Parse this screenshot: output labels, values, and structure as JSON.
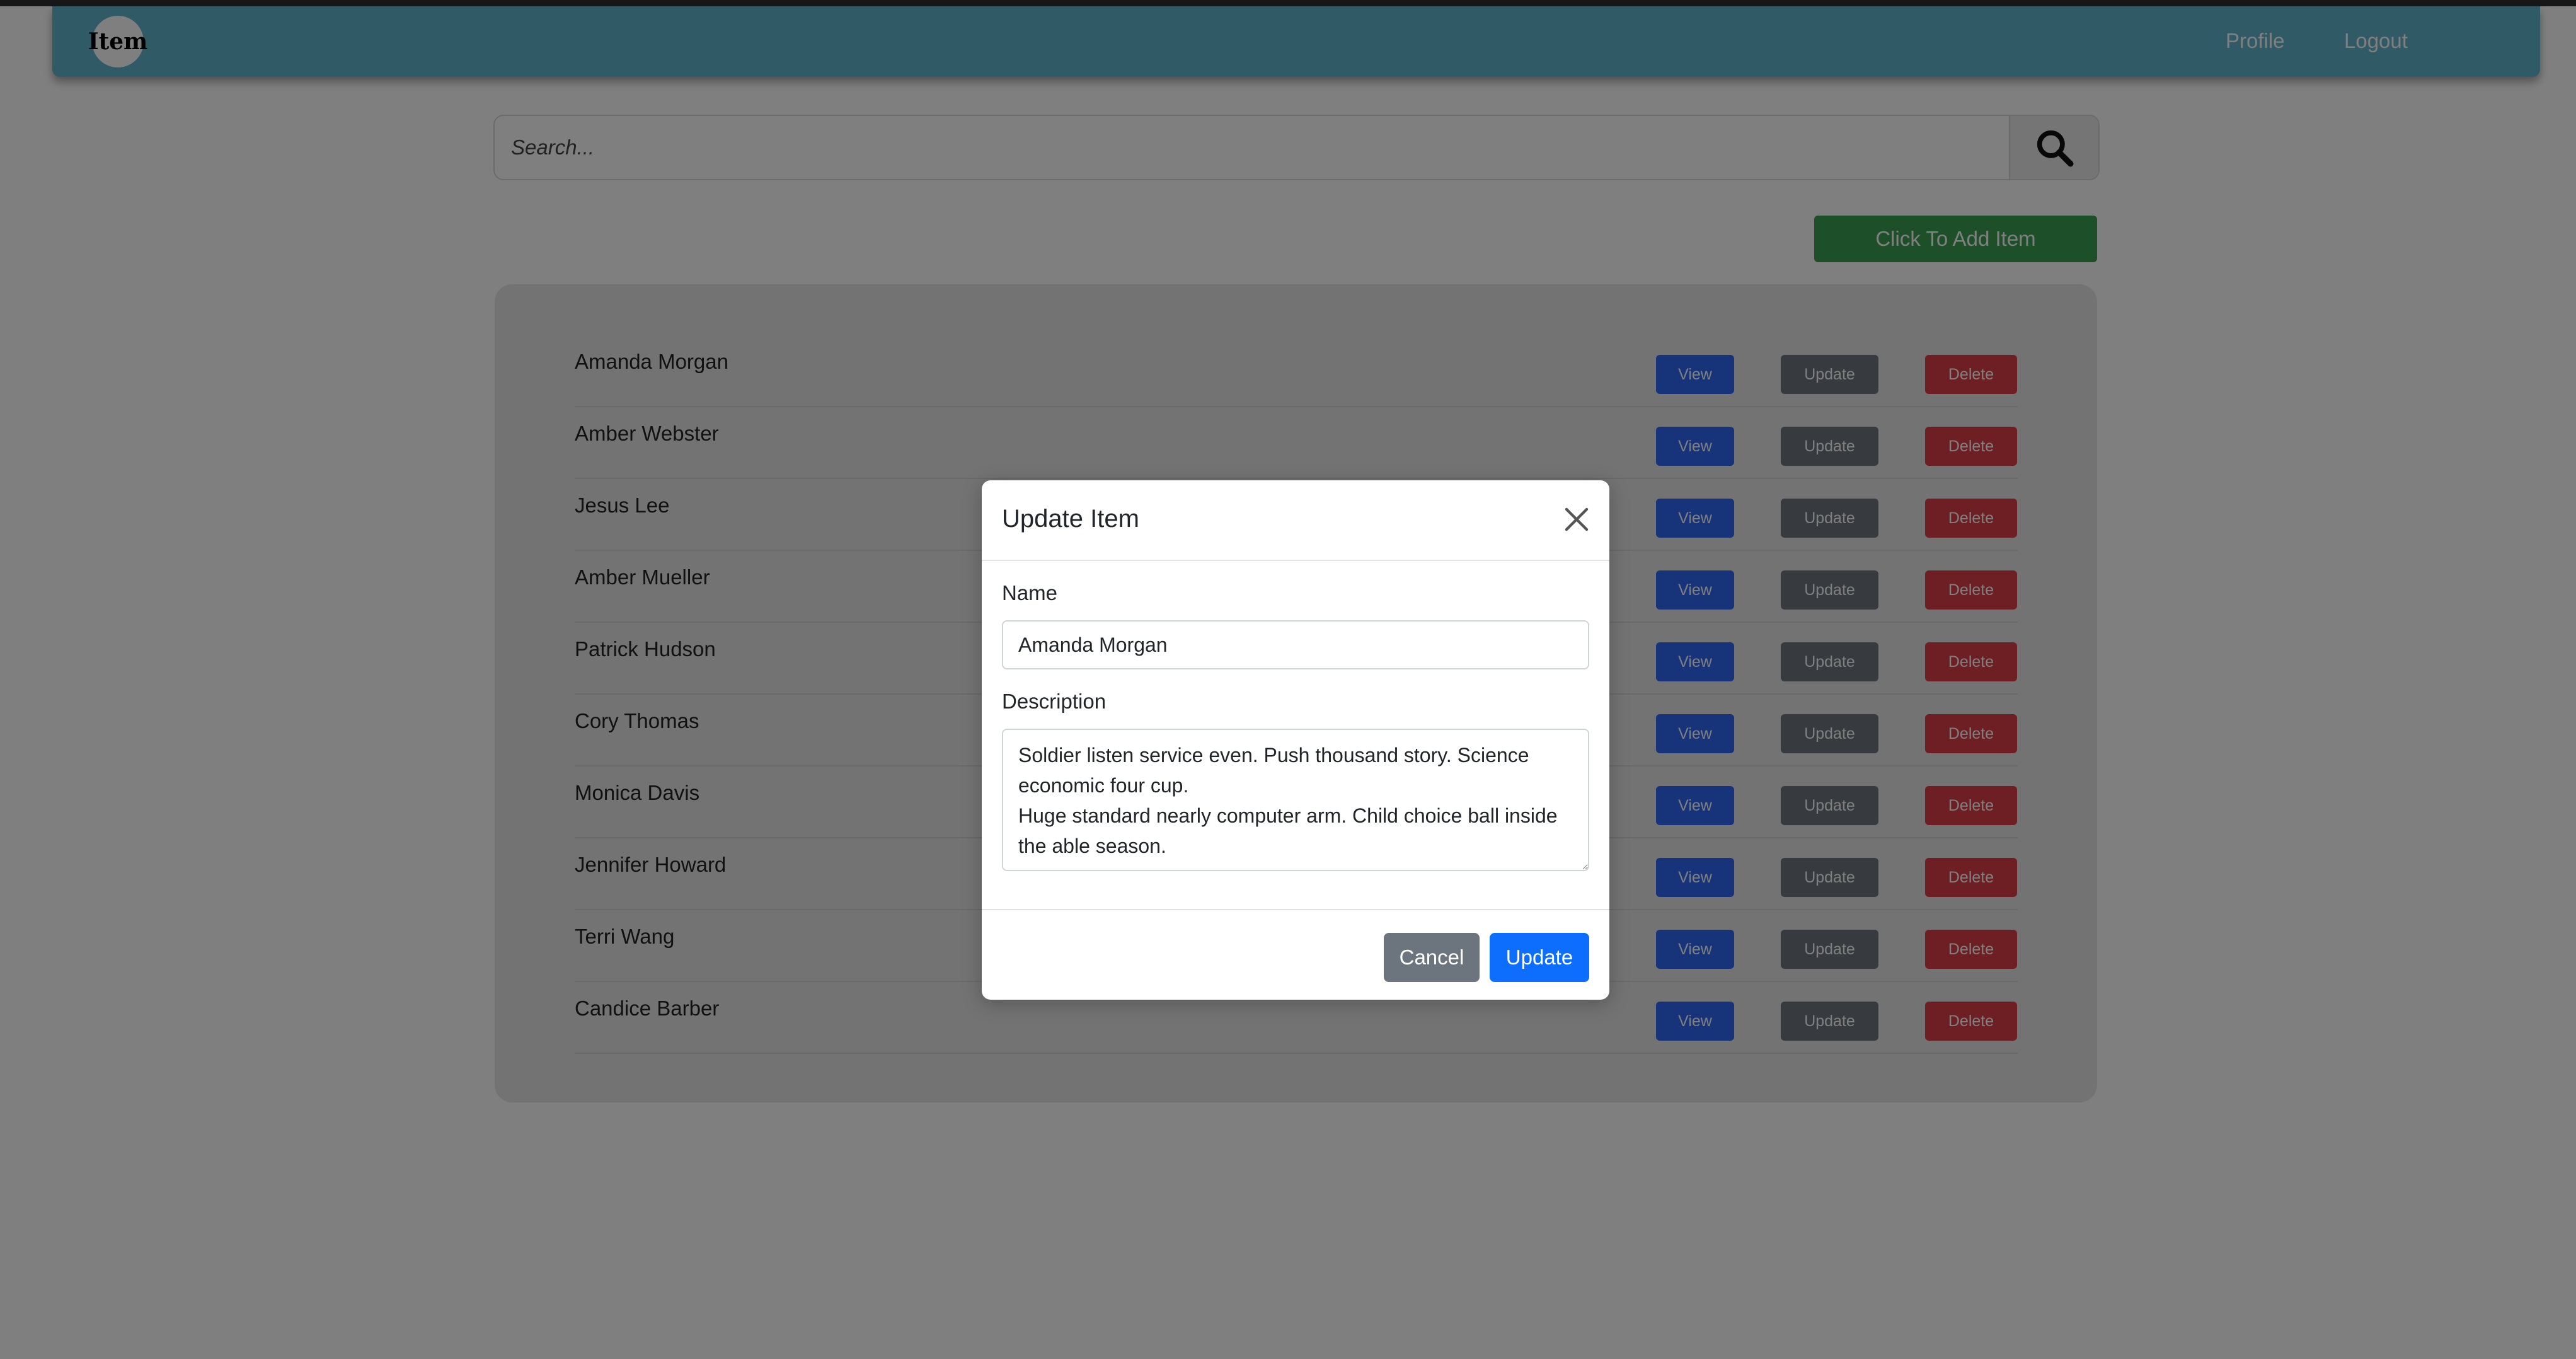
{
  "navbar": {
    "logo_text": "Item",
    "links": [
      "Profile",
      "Logout"
    ]
  },
  "search": {
    "placeholder": "Search...",
    "button_icon": "search-icon"
  },
  "add_button_label": "Click To Add Item",
  "items": [
    {
      "name": "Amanda Morgan"
    },
    {
      "name": "Amber Webster"
    },
    {
      "name": "Jesus Lee"
    },
    {
      "name": "Amber Mueller"
    },
    {
      "name": "Patrick Hudson"
    },
    {
      "name": "Cory Thomas"
    },
    {
      "name": "Monica Davis"
    },
    {
      "name": "Jennifer Howard"
    },
    {
      "name": "Terri Wang"
    },
    {
      "name": "Candice Barber"
    }
  ],
  "row_actions": {
    "view": "View",
    "update": "Update",
    "delete": "Delete"
  },
  "modal": {
    "title": "Update Item",
    "close_icon": "close-icon",
    "name_label": "Name",
    "name_value": "Amanda Morgan",
    "description_label": "Description",
    "description_value": "Soldier listen service even. Push thousand story. Science economic four cup.\nHuge standard nearly computer arm. Child choice ball inside the able season.",
    "cancel_label": "Cancel",
    "update_label": "Update"
  },
  "colors": {
    "navbar": "#5eb4cc",
    "add_button": "#3a9e52",
    "view_button": "#2f68f5",
    "update_button": "#6e767e",
    "delete_button": "#dc3e49",
    "modal_update": "#0d6efd",
    "modal_cancel": "#6c757d"
  }
}
